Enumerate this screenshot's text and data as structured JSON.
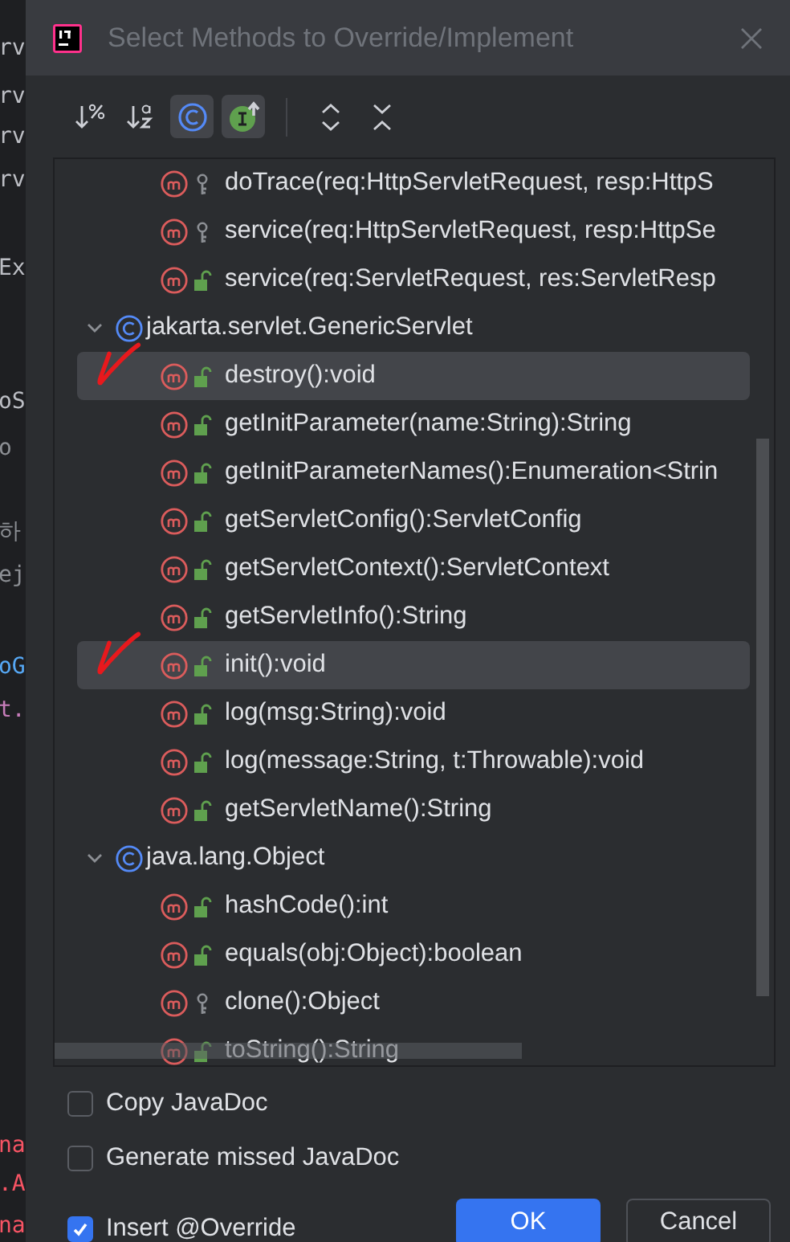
{
  "editor_lines": [
    {
      "text": "rv",
      "color": "#bcbec4"
    },
    {
      "text": "rv",
      "color": "#bcbec4"
    },
    {
      "text": "rv",
      "color": "#bcbec4"
    },
    {
      "text": "rv",
      "color": "#bcbec4"
    },
    {
      "text": "Ex",
      "color": "#bcbec4"
    },
    {
      "text": "oS",
      "color": "#bcbec4"
    },
    {
      "text": "o",
      "color": "#8c8f94"
    },
    {
      "text": "하",
      "color": "#8c8f94"
    },
    {
      "text": "ej",
      "color": "#8c8f94"
    },
    {
      "text": "oG",
      "color": "#56a8f5"
    },
    {
      "text": "t.",
      "color": "#c77dbb"
    },
    {
      "text": "na",
      "color": "#f75464"
    },
    {
      "text": ".A",
      "color": "#f75464"
    },
    {
      "text": "na",
      "color": "#f75464"
    }
  ],
  "window": {
    "title": "Select Methods to Override/Implement"
  },
  "toolbar": [
    {
      "kind": "sort-visibility",
      "selected": false
    },
    {
      "kind": "sort-alpha",
      "selected": false
    },
    {
      "kind": "class-filter",
      "selected": true
    },
    {
      "kind": "interface-filter",
      "selected": true
    },
    {
      "kind": "separator"
    },
    {
      "kind": "expand-all",
      "selected": false
    },
    {
      "kind": "collapse-all",
      "selected": false
    }
  ],
  "tree": [
    {
      "kind": "method",
      "label": "doTrace(req:HttpServletRequest, resp:HttpS",
      "protected": true,
      "selected": false,
      "annotated": false
    },
    {
      "kind": "method",
      "label": "service(req:HttpServletRequest, resp:HttpSe",
      "protected": true,
      "selected": false,
      "annotated": false
    },
    {
      "kind": "method",
      "label": "service(req:ServletRequest, res:ServletResp",
      "protected": false,
      "selected": false,
      "annotated": false
    },
    {
      "kind": "class",
      "label": "jakarta.servlet.GenericServlet",
      "expanded": true,
      "children": [
        {
          "kind": "method",
          "label": "destroy():void",
          "protected": false,
          "selected": true,
          "annotated": true
        },
        {
          "kind": "method",
          "label": "getInitParameter(name:String):String",
          "protected": false,
          "selected": false,
          "annotated": false
        },
        {
          "kind": "method",
          "label": "getInitParameterNames():Enumeration<Strin",
          "protected": false,
          "selected": false,
          "annotated": false
        },
        {
          "kind": "method",
          "label": "getServletConfig():ServletConfig",
          "protected": false,
          "selected": false,
          "annotated": false
        },
        {
          "kind": "method",
          "label": "getServletContext():ServletContext",
          "protected": false,
          "selected": false,
          "annotated": false
        },
        {
          "kind": "method",
          "label": "getServletInfo():String",
          "protected": false,
          "selected": false,
          "annotated": false
        },
        {
          "kind": "method",
          "label": "init():void",
          "protected": false,
          "selected": true,
          "annotated": true
        },
        {
          "kind": "method",
          "label": "log(msg:String):void",
          "protected": false,
          "selected": false,
          "annotated": false
        },
        {
          "kind": "method",
          "label": "log(message:String, t:Throwable):void",
          "protected": false,
          "selected": false,
          "annotated": false
        },
        {
          "kind": "method",
          "label": "getServletName():String",
          "protected": false,
          "selected": false,
          "annotated": false
        }
      ]
    },
    {
      "kind": "class",
      "label": "java.lang.Object",
      "expanded": true,
      "children": [
        {
          "kind": "method",
          "label": "hashCode():int",
          "protected": false,
          "selected": false,
          "annotated": false
        },
        {
          "kind": "method",
          "label": "equals(obj:Object):boolean",
          "protected": false,
          "selected": false,
          "annotated": false
        },
        {
          "kind": "method",
          "label": "clone():Object",
          "protected": true,
          "selected": false,
          "annotated": false
        },
        {
          "kind": "method",
          "label": "toString():String",
          "protected": false,
          "selected": false,
          "annotated": false
        }
      ]
    }
  ],
  "options": [
    {
      "label": "Copy JavaDoc",
      "checked": false
    },
    {
      "label": "Generate missed JavaDoc",
      "checked": false
    },
    {
      "label": "Insert @Override",
      "checked": true
    }
  ],
  "buttons": [
    {
      "label": "OK",
      "kind": "primary"
    },
    {
      "label": "Cancel",
      "kind": "secondary"
    }
  ]
}
